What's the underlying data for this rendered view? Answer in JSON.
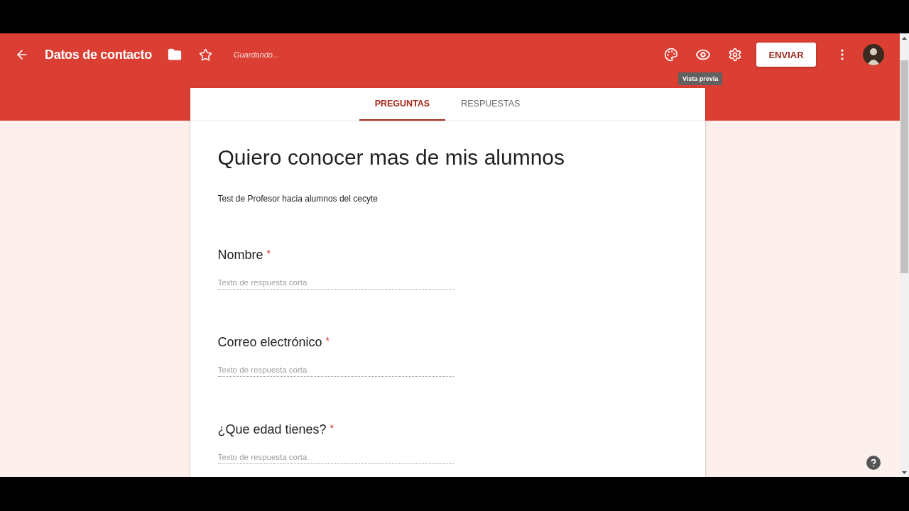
{
  "toolbar": {
    "title": "Datos de contacto",
    "status": "Guardando...",
    "send_button": "ENVIAR",
    "tooltip": "Vista previa"
  },
  "tabs": [
    {
      "label": "PREGUNTAS",
      "selected": true
    },
    {
      "label": "RESPUESTAS",
      "selected": false
    }
  ],
  "form": {
    "title": "Quiero conocer mas de mis alumnos",
    "description": "Test de Profesor hacia alumnos del cecyte"
  },
  "questions": [
    {
      "label": "Nombre",
      "required_mark": "*",
      "placeholder": "Texto de respuesta corta"
    },
    {
      "label": "Correo electrónico",
      "required_mark": "*",
      "placeholder": "Texto de respuesta corta"
    },
    {
      "label": "¿Que edad tienes?",
      "required_mark": "*",
      "placeholder": "Texto de respuesta corta"
    }
  ]
}
